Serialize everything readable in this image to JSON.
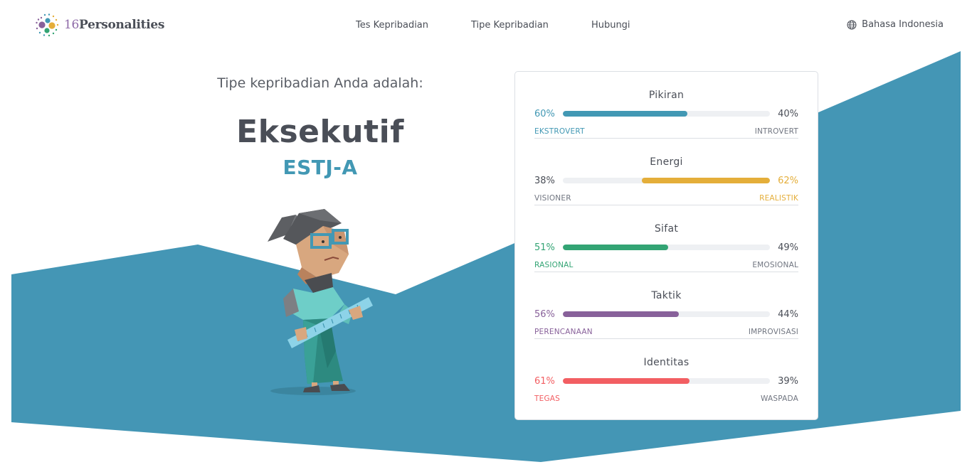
{
  "header": {
    "logo_text": "Personalities",
    "logo_number": "16",
    "nav": [
      "Tes Kepribadian",
      "Tipe Kepribadian",
      "Hubungi"
    ],
    "language": "Bahasa Indonesia"
  },
  "hero": {
    "intro": "Tipe kepribadian Anda adalah:",
    "type_name": "Eksekutif",
    "type_code": "ESTJ-A"
  },
  "traits": [
    {
      "title": "Pikiran",
      "left_pct": "60%",
      "right_pct": "40%",
      "left_label": "EKSTROVERT",
      "right_label": "INTROVERT",
      "value": 0.6,
      "dominant": "left",
      "color": "#4298b4"
    },
    {
      "title": "Energi",
      "left_pct": "38%",
      "right_pct": "62%",
      "left_label": "VISIONER",
      "right_label": "REALISTIK",
      "value": 0.62,
      "dominant": "right",
      "color": "#e4ae3a"
    },
    {
      "title": "Sifat",
      "left_pct": "51%",
      "right_pct": "49%",
      "left_label": "RASIONAL",
      "right_label": "EMOSIONAL",
      "value": 0.51,
      "dominant": "left",
      "color": "#33a474"
    },
    {
      "title": "Taktik",
      "left_pct": "56%",
      "right_pct": "44%",
      "left_label": "PERENCANAAN",
      "right_label": "IMPROVISASI",
      "value": 0.56,
      "dominant": "left",
      "color": "#88619a"
    },
    {
      "title": "Identitas",
      "left_pct": "61%",
      "right_pct": "39%",
      "left_label": "TEGAS",
      "right_label": "WASPADA",
      "value": 0.61,
      "dominant": "left",
      "color": "#f25e62"
    }
  ],
  "colors": {
    "background_shape": "#4496b5",
    "text": "#4a4e57",
    "accent": "#4298b4"
  }
}
